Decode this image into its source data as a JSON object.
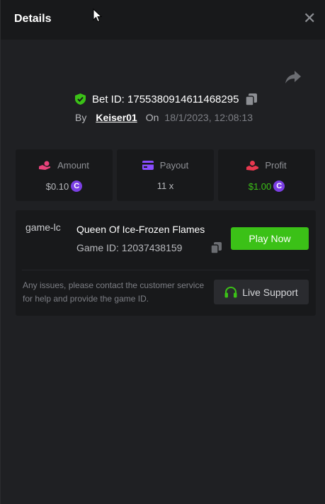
{
  "header": {
    "title": "Details",
    "close_icon": "close-icon"
  },
  "bet": {
    "id_label": "Bet ID: 1755380914611468295",
    "by_label": "By",
    "user": "Keiser01",
    "on_label": "On",
    "date": "18/1/2023, 12:08:13"
  },
  "stats": [
    {
      "label": "Amount",
      "value": "$0.10",
      "icon": "hand-coin-icon",
      "icon_color": "#e8437b",
      "value_color": "#b8b9bd",
      "coin": true
    },
    {
      "label": "Payout",
      "value": "11 x",
      "icon": "card-icon",
      "icon_color": "#8a4dff",
      "value_color": "#b8b9bd",
      "coin": false
    },
    {
      "label": "Profit",
      "value": "$1.00",
      "icon": "hand-profit-icon",
      "icon_color": "#e8384f",
      "value_color": "#3bc117",
      "coin": true
    }
  ],
  "coin_symbol": "C",
  "game": {
    "thumb_alt": "game-lc",
    "name": "Queen Of Ice-Frozen Flames",
    "id_label": "Game ID: 12037438159",
    "play_label": "Play Now"
  },
  "support": {
    "note": "Any issues, please contact the customer service for help and provide the game ID.",
    "button_label": "Live Support"
  },
  "colors": {
    "accent_green": "#3bc117",
    "shield_green": "#3bc117",
    "coin_purple": "#7b3fe4"
  }
}
